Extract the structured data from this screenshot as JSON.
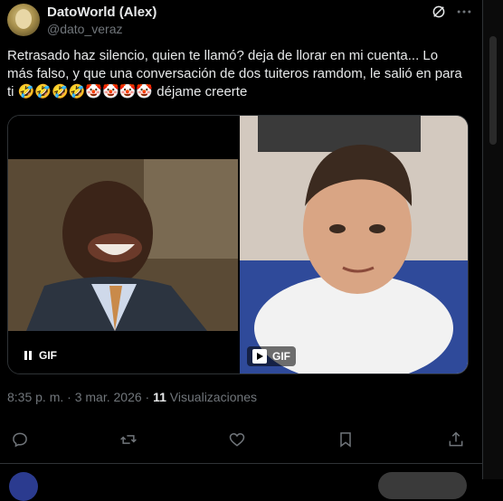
{
  "author": {
    "display_name": "DatoWorld (Alex)",
    "handle": "@dato_veraz"
  },
  "tweet": {
    "text_main": "Retrasado haz silencio, quien te llamó? deja de llorar en mi cuenta... Lo más falso, y que una conversación de dos tuiteros ramdom, le salió en para ti ",
    "emojis": "🤣🤣🤣🤣🤡🤡🤡🤡",
    "text_end": " déjame creerte"
  },
  "media": {
    "left_gif_label": "GIF",
    "right_gif_label": "GIF"
  },
  "meta": {
    "time": "8:35 p. m.",
    "sep1": " · ",
    "date": "3 mar. 2026",
    "sep2": " · ",
    "views_count": "11",
    "views_label": " Visualizaciones"
  },
  "icons": {
    "grok": "grok-icon",
    "more": "more-icon",
    "reply": "reply-icon",
    "repost": "repost-icon",
    "like": "heart-icon",
    "bookmark": "bookmark-icon",
    "share": "share-icon"
  },
  "colors": {
    "background": "#000000",
    "text": "#e7e9ea",
    "muted": "#71767b",
    "border": "#2f3336"
  }
}
